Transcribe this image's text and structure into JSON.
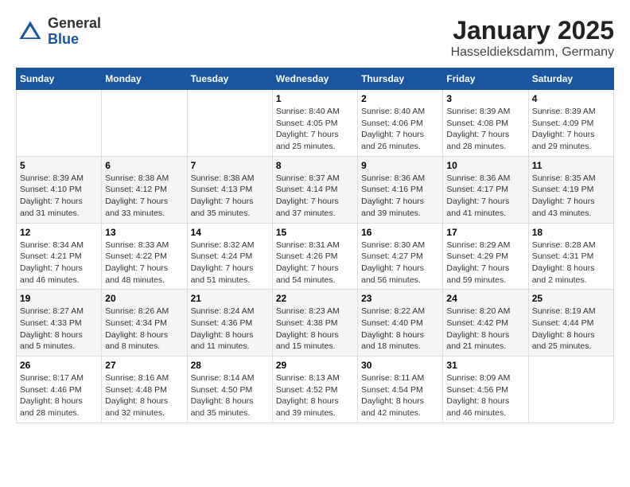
{
  "header": {
    "logo_general": "General",
    "logo_blue": "Blue",
    "month_title": "January 2025",
    "location": "Hasseldieksdamm, Germany"
  },
  "weekdays": [
    "Sunday",
    "Monday",
    "Tuesday",
    "Wednesday",
    "Thursday",
    "Friday",
    "Saturday"
  ],
  "weeks": [
    [
      {
        "day": "",
        "sunrise": "",
        "sunset": "",
        "daylight": ""
      },
      {
        "day": "",
        "sunrise": "",
        "sunset": "",
        "daylight": ""
      },
      {
        "day": "",
        "sunrise": "",
        "sunset": "",
        "daylight": ""
      },
      {
        "day": "1",
        "sunrise": "Sunrise: 8:40 AM",
        "sunset": "Sunset: 4:05 PM",
        "daylight": "Daylight: 7 hours and 25 minutes."
      },
      {
        "day": "2",
        "sunrise": "Sunrise: 8:40 AM",
        "sunset": "Sunset: 4:06 PM",
        "daylight": "Daylight: 7 hours and 26 minutes."
      },
      {
        "day": "3",
        "sunrise": "Sunrise: 8:39 AM",
        "sunset": "Sunset: 4:08 PM",
        "daylight": "Daylight: 7 hours and 28 minutes."
      },
      {
        "day": "4",
        "sunrise": "Sunrise: 8:39 AM",
        "sunset": "Sunset: 4:09 PM",
        "daylight": "Daylight: 7 hours and 29 minutes."
      }
    ],
    [
      {
        "day": "5",
        "sunrise": "Sunrise: 8:39 AM",
        "sunset": "Sunset: 4:10 PM",
        "daylight": "Daylight: 7 hours and 31 minutes."
      },
      {
        "day": "6",
        "sunrise": "Sunrise: 8:38 AM",
        "sunset": "Sunset: 4:12 PM",
        "daylight": "Daylight: 7 hours and 33 minutes."
      },
      {
        "day": "7",
        "sunrise": "Sunrise: 8:38 AM",
        "sunset": "Sunset: 4:13 PM",
        "daylight": "Daylight: 7 hours and 35 minutes."
      },
      {
        "day": "8",
        "sunrise": "Sunrise: 8:37 AM",
        "sunset": "Sunset: 4:14 PM",
        "daylight": "Daylight: 7 hours and 37 minutes."
      },
      {
        "day": "9",
        "sunrise": "Sunrise: 8:36 AM",
        "sunset": "Sunset: 4:16 PM",
        "daylight": "Daylight: 7 hours and 39 minutes."
      },
      {
        "day": "10",
        "sunrise": "Sunrise: 8:36 AM",
        "sunset": "Sunset: 4:17 PM",
        "daylight": "Daylight: 7 hours and 41 minutes."
      },
      {
        "day": "11",
        "sunrise": "Sunrise: 8:35 AM",
        "sunset": "Sunset: 4:19 PM",
        "daylight": "Daylight: 7 hours and 43 minutes."
      }
    ],
    [
      {
        "day": "12",
        "sunrise": "Sunrise: 8:34 AM",
        "sunset": "Sunset: 4:21 PM",
        "daylight": "Daylight: 7 hours and 46 minutes."
      },
      {
        "day": "13",
        "sunrise": "Sunrise: 8:33 AM",
        "sunset": "Sunset: 4:22 PM",
        "daylight": "Daylight: 7 hours and 48 minutes."
      },
      {
        "day": "14",
        "sunrise": "Sunrise: 8:32 AM",
        "sunset": "Sunset: 4:24 PM",
        "daylight": "Daylight: 7 hours and 51 minutes."
      },
      {
        "day": "15",
        "sunrise": "Sunrise: 8:31 AM",
        "sunset": "Sunset: 4:26 PM",
        "daylight": "Daylight: 7 hours and 54 minutes."
      },
      {
        "day": "16",
        "sunrise": "Sunrise: 8:30 AM",
        "sunset": "Sunset: 4:27 PM",
        "daylight": "Daylight: 7 hours and 56 minutes."
      },
      {
        "day": "17",
        "sunrise": "Sunrise: 8:29 AM",
        "sunset": "Sunset: 4:29 PM",
        "daylight": "Daylight: 7 hours and 59 minutes."
      },
      {
        "day": "18",
        "sunrise": "Sunrise: 8:28 AM",
        "sunset": "Sunset: 4:31 PM",
        "daylight": "Daylight: 8 hours and 2 minutes."
      }
    ],
    [
      {
        "day": "19",
        "sunrise": "Sunrise: 8:27 AM",
        "sunset": "Sunset: 4:33 PM",
        "daylight": "Daylight: 8 hours and 5 minutes."
      },
      {
        "day": "20",
        "sunrise": "Sunrise: 8:26 AM",
        "sunset": "Sunset: 4:34 PM",
        "daylight": "Daylight: 8 hours and 8 minutes."
      },
      {
        "day": "21",
        "sunrise": "Sunrise: 8:24 AM",
        "sunset": "Sunset: 4:36 PM",
        "daylight": "Daylight: 8 hours and 11 minutes."
      },
      {
        "day": "22",
        "sunrise": "Sunrise: 8:23 AM",
        "sunset": "Sunset: 4:38 PM",
        "daylight": "Daylight: 8 hours and 15 minutes."
      },
      {
        "day": "23",
        "sunrise": "Sunrise: 8:22 AM",
        "sunset": "Sunset: 4:40 PM",
        "daylight": "Daylight: 8 hours and 18 minutes."
      },
      {
        "day": "24",
        "sunrise": "Sunrise: 8:20 AM",
        "sunset": "Sunset: 4:42 PM",
        "daylight": "Daylight: 8 hours and 21 minutes."
      },
      {
        "day": "25",
        "sunrise": "Sunrise: 8:19 AM",
        "sunset": "Sunset: 4:44 PM",
        "daylight": "Daylight: 8 hours and 25 minutes."
      }
    ],
    [
      {
        "day": "26",
        "sunrise": "Sunrise: 8:17 AM",
        "sunset": "Sunset: 4:46 PM",
        "daylight": "Daylight: 8 hours and 28 minutes."
      },
      {
        "day": "27",
        "sunrise": "Sunrise: 8:16 AM",
        "sunset": "Sunset: 4:48 PM",
        "daylight": "Daylight: 8 hours and 32 minutes."
      },
      {
        "day": "28",
        "sunrise": "Sunrise: 8:14 AM",
        "sunset": "Sunset: 4:50 PM",
        "daylight": "Daylight: 8 hours and 35 minutes."
      },
      {
        "day": "29",
        "sunrise": "Sunrise: 8:13 AM",
        "sunset": "Sunset: 4:52 PM",
        "daylight": "Daylight: 8 hours and 39 minutes."
      },
      {
        "day": "30",
        "sunrise": "Sunrise: 8:11 AM",
        "sunset": "Sunset: 4:54 PM",
        "daylight": "Daylight: 8 hours and 42 minutes."
      },
      {
        "day": "31",
        "sunrise": "Sunrise: 8:09 AM",
        "sunset": "Sunset: 4:56 PM",
        "daylight": "Daylight: 8 hours and 46 minutes."
      },
      {
        "day": "",
        "sunrise": "",
        "sunset": "",
        "daylight": ""
      }
    ]
  ]
}
